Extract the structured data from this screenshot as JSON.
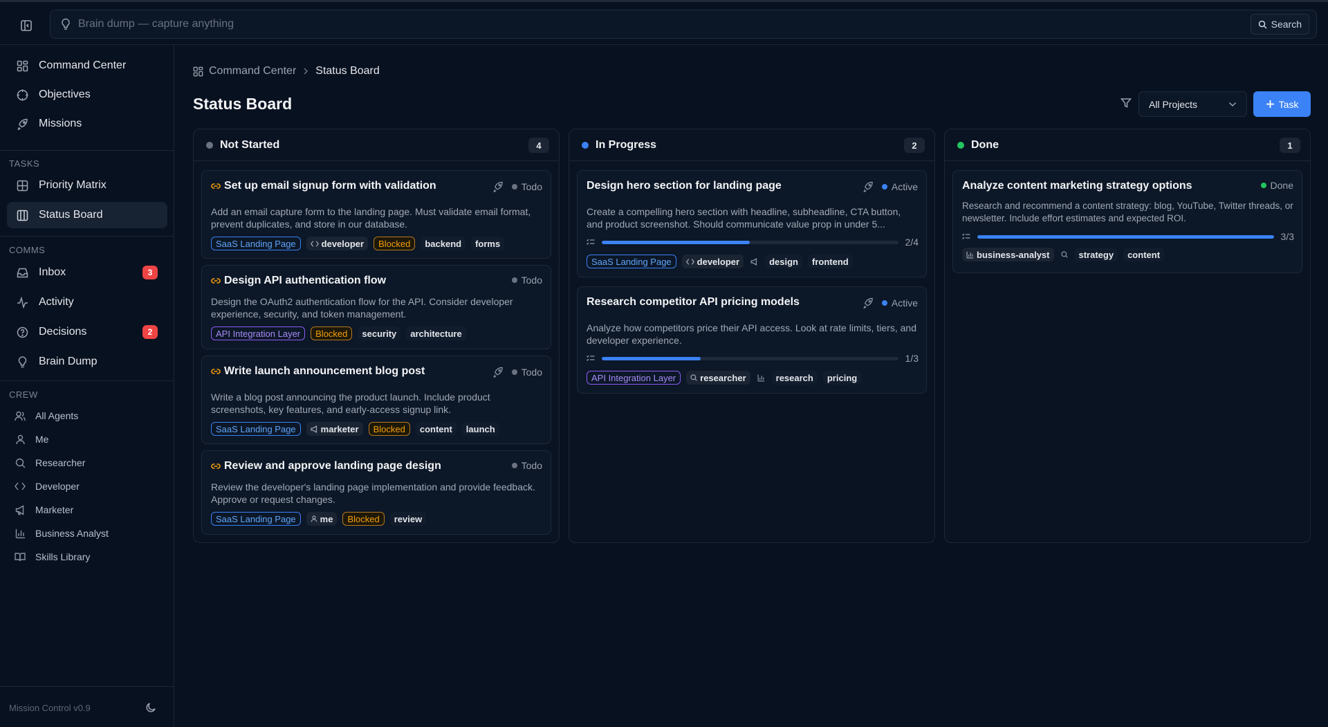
{
  "header": {
    "brain_placeholder": "Brain dump — capture anything",
    "search_label": "Search"
  },
  "sidebar": {
    "main": [
      {
        "label": "Command Center",
        "icon": "grid-icon"
      },
      {
        "label": "Objectives",
        "icon": "target-icon"
      },
      {
        "label": "Missions",
        "icon": "rocket-icon"
      }
    ],
    "tasks_label": "TASKS",
    "tasks": [
      {
        "label": "Priority Matrix",
        "icon": "matrix-icon"
      },
      {
        "label": "Status Board",
        "icon": "board-icon",
        "active": true
      }
    ],
    "comms_label": "COMMS",
    "comms": [
      {
        "label": "Inbox",
        "icon": "inbox-icon",
        "badge": "3"
      },
      {
        "label": "Activity",
        "icon": "activity-icon"
      },
      {
        "label": "Decisions",
        "icon": "help-circle-icon",
        "badge": "2"
      },
      {
        "label": "Brain Dump",
        "icon": "lightbulb-icon"
      }
    ],
    "crew_label": "CREW",
    "crew": [
      {
        "label": "All Agents",
        "icon": "users-icon"
      },
      {
        "label": "Me",
        "icon": "user-icon"
      },
      {
        "label": "Researcher",
        "icon": "search-icon"
      },
      {
        "label": "Developer",
        "icon": "code-icon"
      },
      {
        "label": "Marketer",
        "icon": "megaphone-icon"
      },
      {
        "label": "Business Analyst",
        "icon": "bar-chart-icon"
      },
      {
        "label": "Skills Library",
        "icon": "book-icon"
      }
    ],
    "version": "Mission Control v0.9"
  },
  "main": {
    "breadcrumb": {
      "root": "Command Center",
      "current": "Status Board"
    },
    "title": "Status Board",
    "project_filter": "All Projects",
    "add_task_label": "Task"
  },
  "columns": [
    {
      "title": "Not Started",
      "count": "4",
      "dot_color": "#6b7280",
      "cards": [
        {
          "title": "Set up email signup form with validation",
          "status": "Todo",
          "status_color": "#6b7280",
          "rocket": true,
          "desc": "Add an email capture form to the landing page. Must validate email format, prevent duplicates, and store in our database.",
          "project": "SaaS Landing Page",
          "agent": "developer",
          "blocked": "Blocked",
          "labels": [
            "backend",
            "forms"
          ]
        },
        {
          "title": "Design API authentication flow",
          "status": "Todo",
          "status_color": "#6b7280",
          "rocket": false,
          "desc": "Design the OAuth2 authentication flow for the API. Consider developer experience, security, and token management.",
          "project": "API Integration Layer",
          "blocked": "Blocked",
          "labels": [
            "security",
            "architecture"
          ]
        },
        {
          "title": "Write launch announcement blog post",
          "status": "Todo",
          "status_color": "#6b7280",
          "rocket": true,
          "desc": "Write a blog post announcing the product launch. Include product screenshots, key features, and early-access signup link.",
          "project": "SaaS Landing Page",
          "agent": "marketer",
          "blocked": "Blocked",
          "labels": [
            "content",
            "launch"
          ]
        },
        {
          "title": "Review and approve landing page design",
          "status": "Todo",
          "status_color": "#6b7280",
          "rocket": false,
          "desc": "Review the developer's landing page implementation and provide feedback. Approve or request changes.",
          "project": "SaaS Landing Page",
          "agent": "me",
          "blocked": "Blocked",
          "labels": [
            "review"
          ]
        }
      ]
    },
    {
      "title": "In Progress",
      "count": "2",
      "dot_color": "#3b82f6",
      "cards": [
        {
          "title": "Design hero section for landing page",
          "status": "Active",
          "status_color": "#3b82f6",
          "rocket": true,
          "desc": "Create a compelling hero section with headline, subheadline, CTA button, and product screenshot. Should communicate value prop in under 5...",
          "progress_text": "2/4",
          "progress": 0.5,
          "project": "SaaS Landing Page",
          "agent": "developer",
          "labels": [
            "design",
            "frontend"
          ]
        },
        {
          "title": "Research competitor API pricing models",
          "status": "Active",
          "status_color": "#3b82f6",
          "rocket": true,
          "desc": "Analyze how competitors price their API access. Look at rate limits, tiers, and developer experience.",
          "progress_text": "1/3",
          "progress": 0.333,
          "project": "API Integration Layer",
          "agent": "researcher",
          "labels": [
            "research",
            "pricing"
          ]
        }
      ]
    },
    {
      "title": "Done",
      "count": "1",
      "dot_color": "#22c55e",
      "cards": [
        {
          "title": "Analyze content marketing strategy options",
          "status": "Done",
          "status_color": "#22c55e",
          "rocket": false,
          "desc": "Research and recommend a content strategy: blog, YouTube, Twitter threads, or newsletter. Include effort estimates and expected ROI.",
          "progress_text": "3/3",
          "progress": 1.0,
          "agent": "business-analyst",
          "labels": [
            "strategy",
            "content"
          ]
        }
      ]
    }
  ]
}
